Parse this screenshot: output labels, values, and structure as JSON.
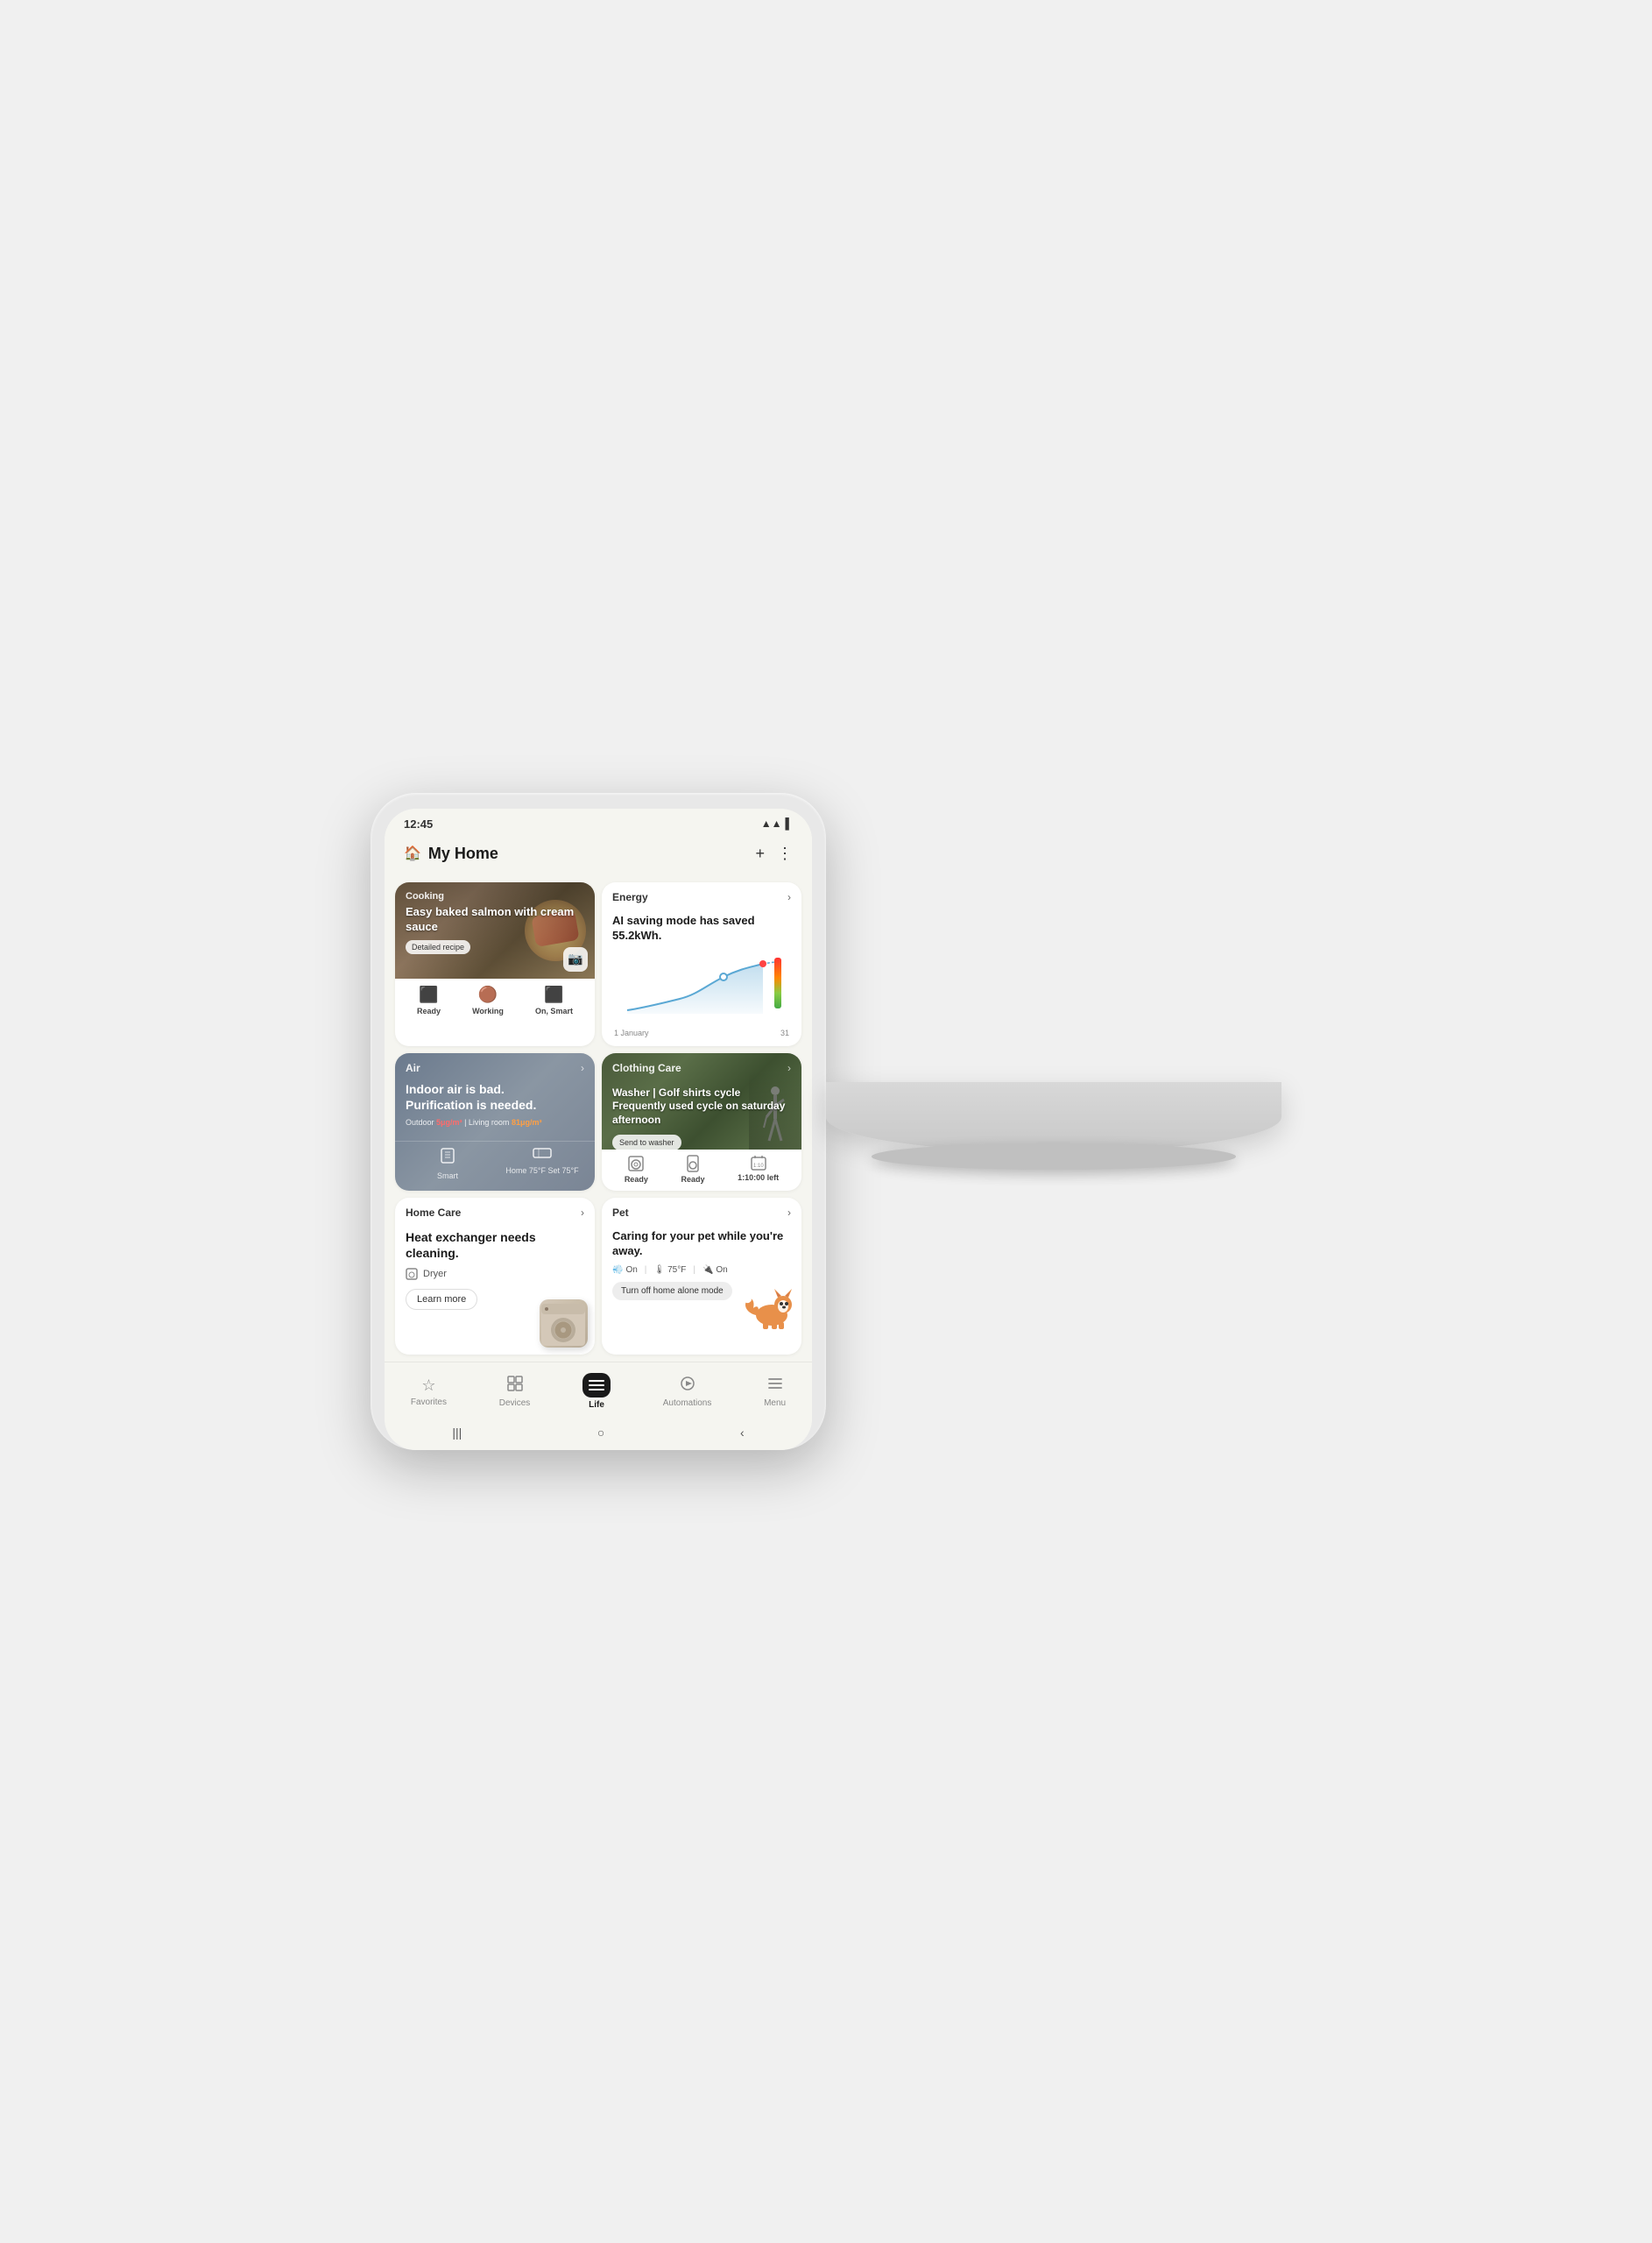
{
  "device": {
    "time": "12:45",
    "signal_icon": "📶",
    "battery_icon": "🔋"
  },
  "header": {
    "home_icon": "🏠",
    "title": "My Home",
    "add_icon": "+",
    "menu_icon": "⋮"
  },
  "cooking_card": {
    "section": "Cooking",
    "arrow": "›",
    "recipe_title": "Easy baked salmon with cream sauce",
    "badge": "Detailed recipe",
    "camera_icon": "📷",
    "devices": [
      {
        "icon": "⬛",
        "label": "Ready"
      },
      {
        "icon": "🔵",
        "label": "Working"
      },
      {
        "icon": "⬛",
        "label": "On, Smart"
      }
    ]
  },
  "energy_card": {
    "section": "Energy",
    "arrow": "›",
    "subtitle": "AI saving mode has saved 55.2kWh.",
    "date_start": "1 January",
    "date_end": "31"
  },
  "air_card": {
    "section": "Air",
    "arrow": "›",
    "headline_line1": "Indoor air is bad.",
    "headline_line2": "Purification is needed.",
    "outdoor_label": "Outdoor",
    "outdoor_val": "5μg/m³",
    "living_label": "Living room",
    "living_val": "81μg/m³",
    "devices": [
      {
        "icon": "⊞",
        "label": "Smart"
      },
      {
        "icon": "▭",
        "label": "Home 75°F Set 75°F"
      }
    ]
  },
  "clothing_card": {
    "section": "Clothing Care",
    "arrow": "›",
    "recipe_title": "Washer | Golf shirts cycle Frequently used cycle on saturday afternoon",
    "send_btn": "Send to washer",
    "devices": [
      {
        "icon": "🔵",
        "label": "Ready"
      },
      {
        "icon": "🔵",
        "label": "Ready"
      },
      {
        "icon": "⏱",
        "label": "1:10:00 left"
      }
    ]
  },
  "homecare_card": {
    "section": "Home Care",
    "arrow": "›",
    "headline": "Heat exchanger needs cleaning.",
    "device_icon": "⬛",
    "device_label": "Dryer",
    "learn_more": "Learn more"
  },
  "pet_card": {
    "section": "Pet",
    "arrow": "›",
    "headline": "Caring for your pet while you're away.",
    "status": [
      {
        "icon": "💨",
        "val": "On"
      },
      {
        "sep": true
      },
      {
        "icon": "🛏",
        "val": "75°F"
      },
      {
        "sep": true
      },
      {
        "icon": "🔋",
        "val": "On"
      }
    ],
    "turn_off_btn": "Turn off home alone mode"
  },
  "bottom_nav": {
    "items": [
      {
        "icon": "☆",
        "label": "Favorites",
        "active": false
      },
      {
        "icon": "⊞",
        "label": "Devices",
        "active": false
      },
      {
        "icon": "☰",
        "label": "Life",
        "active": true
      },
      {
        "icon": "▷",
        "label": "Automations",
        "active": false
      },
      {
        "icon": "≡",
        "label": "Menu",
        "active": false
      }
    ]
  },
  "system_nav": {
    "back": "‹",
    "home": "○",
    "recent": "|||"
  }
}
